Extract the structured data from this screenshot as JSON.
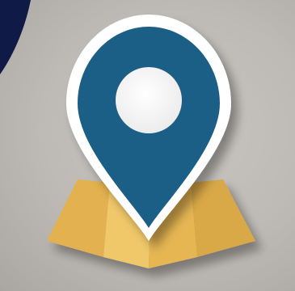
{
  "scene": {
    "icon": "map-location-pin-icon",
    "elements": [
      {
        "name": "dark-navy-corner-shape",
        "color": "#0f1a47"
      },
      {
        "name": "folded-map-icon",
        "color": "#e9bb55"
      },
      {
        "name": "location-pin-icon",
        "color": "#1f5f86",
        "outline": "#ffffff"
      },
      {
        "name": "pin-center-dot",
        "color": "#ffffff"
      }
    ]
  }
}
